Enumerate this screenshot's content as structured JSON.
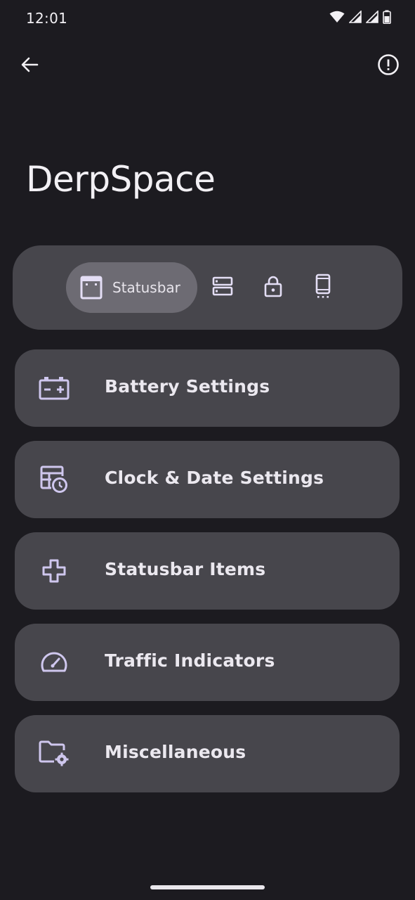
{
  "status_bar": {
    "time": "12:01",
    "icons": [
      "wifi-icon",
      "signal-icon",
      "signal-icon",
      "battery-icon"
    ]
  },
  "app_bar": {
    "back_icon": "arrow-back-icon",
    "info_icon": "info-icon"
  },
  "page": {
    "title": "DerpSpace"
  },
  "selector": {
    "active": {
      "label": "Statusbar",
      "icon": "statusbar-icon"
    },
    "others": [
      {
        "icon": "quick-settings-icon"
      },
      {
        "icon": "lock-icon"
      },
      {
        "icon": "phone-icon"
      }
    ]
  },
  "menu": {
    "items": [
      {
        "label": "Battery Settings",
        "icon": "battery-settings-icon"
      },
      {
        "label": "Clock & Date Settings",
        "icon": "clock-date-icon"
      },
      {
        "label": "Statusbar Items",
        "icon": "plus-outline-icon"
      },
      {
        "label": "Traffic Indicators",
        "icon": "speedometer-icon"
      },
      {
        "label": "Miscellaneous",
        "icon": "folder-settings-icon"
      }
    ]
  },
  "colors": {
    "background": "#1c1b20",
    "card": "#47464c",
    "active_segment": "#6d6b73",
    "icon_tint": "#cfc7ee",
    "text": "#ebe8ef"
  }
}
